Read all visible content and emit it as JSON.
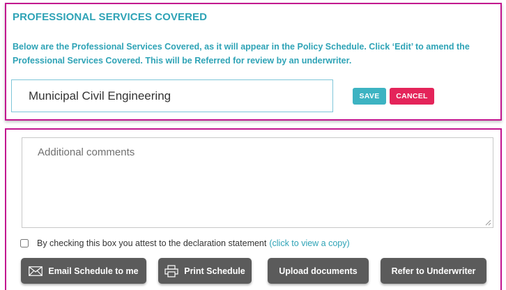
{
  "services_panel": {
    "heading": "PROFESSIONAL SERVICES COVERED",
    "description": "Below are the Professional Services Covered, as it will appear in the Policy Schedule. Click ‘Edit’ to amend the Professional Services Covered. This will be Referred for review by an underwriter.",
    "input_value": "Municipal Civil Engineering",
    "save_label": "SAVE",
    "cancel_label": "CANCEL"
  },
  "comments_panel": {
    "comments_placeholder": "Additional comments",
    "declaration_text": "By checking this box you attest to the declaration statement",
    "declaration_link": "(click to view a copy)",
    "declaration_checked": false,
    "buttons": {
      "email": "Email Schedule to me",
      "print": "Print Schedule",
      "upload": "Upload documents",
      "refer": "Refer to Underwriter"
    }
  },
  "colors": {
    "accent_teal": "#2ea3b6",
    "save_button": "#3db3c2",
    "cancel_button": "#e4245a",
    "panel_border": "#c2168f",
    "action_button": "#5b5b5b"
  },
  "icons": {
    "email": "envelope-icon",
    "print": "printer-icon"
  }
}
